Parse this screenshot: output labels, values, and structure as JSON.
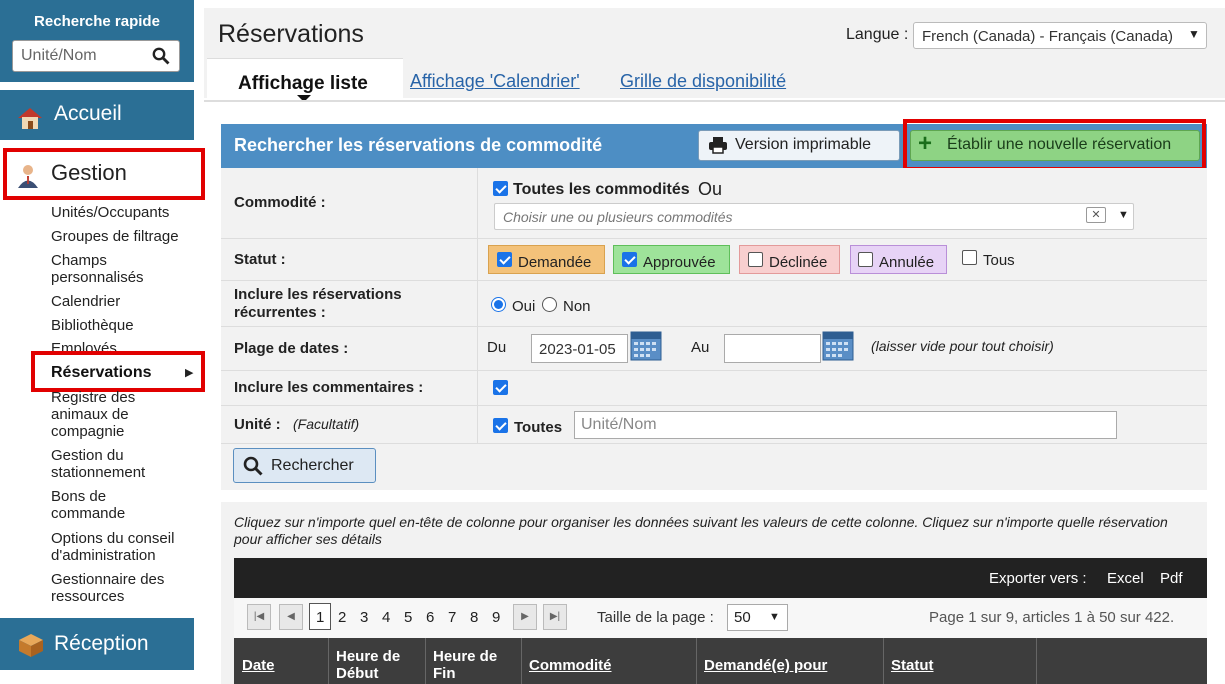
{
  "sidebar": {
    "quick_search_title": "Recherche rapide",
    "quick_search_placeholder": "Unité/Nom",
    "home_label": "Accueil",
    "management_label": "Gestion",
    "items": [
      {
        "label": "Unités/Occupants"
      },
      {
        "label": "Groupes de filtrage"
      },
      {
        "label": "Champs personnalisés"
      },
      {
        "label": "Calendrier"
      },
      {
        "label": "Bibliothèque"
      },
      {
        "label": "Employés"
      },
      {
        "label": "Réservations"
      },
      {
        "label": "Registre des animaux de compagnie"
      },
      {
        "label": "Gestion du stationnement"
      },
      {
        "label": "Bons de commande"
      },
      {
        "label": "Options du conseil d'administration"
      },
      {
        "label": "Gestionnaire des ressources"
      }
    ],
    "reception_label": "Réception"
  },
  "header": {
    "title": "Réservations",
    "language_label": "Langue :",
    "language_value": "French (Canada) - Français (Canada)",
    "tabs": [
      {
        "label": "Affichage liste"
      },
      {
        "label": "Affichage 'Calendrier'"
      },
      {
        "label": "Grille de disponibilité"
      }
    ]
  },
  "search": {
    "title": "Rechercher les réservations de commodité",
    "print_button": "Version imprimable",
    "new_button": "Établir une nouvelle réservation",
    "amenity_label": "Commodité :",
    "all_amenities": "Toutes les commodités",
    "or_text": "Ou",
    "amenity_placeholder": "Choisir une ou plusieurs commodités",
    "status_label": "Statut :",
    "statuses": [
      {
        "label": "Demandée",
        "checked": true,
        "bg": "#f3c27a",
        "border": "#d9a24f"
      },
      {
        "label": "Approuvée",
        "checked": true,
        "bg": "#9ee39a",
        "border": "#5fbf5a"
      },
      {
        "label": "Déclinée",
        "checked": false,
        "bg": "#f8cfcf",
        "border": "#e39a9a"
      },
      {
        "label": "Annulée",
        "checked": false,
        "bg": "#e7d3f6",
        "border": "#b98fd8"
      }
    ],
    "all_status": "Tous",
    "recurring_label": "Inclure les réservations récurrentes :",
    "yes": "Oui",
    "no": "Non",
    "date_label": "Plage de dates :",
    "from": "Du",
    "from_value": "2023-01-05",
    "to": "Au",
    "to_value": "",
    "date_hint": "(laisser vide pour tout choisir)",
    "comments_label": "Inclure les commentaires :",
    "unit_label": "Unité :",
    "unit_optional": "(Facultatif)",
    "unit_all": "Toutes",
    "unit_placeholder": "Unité/Nom",
    "search_button": "Rechercher"
  },
  "results": {
    "hint": "Cliquez sur n'importe quel en-tête de colonne pour organiser les données suivant les valeurs de cette colonne. Cliquez sur n'importe quelle réservation pour afficher ses détails",
    "export_label": "Exporter vers :",
    "export_excel": "Excel",
    "export_pdf": "Pdf",
    "pages": [
      "1",
      "2",
      "3",
      "4",
      "5",
      "6",
      "7",
      "8",
      "9"
    ],
    "page_size_label": "Taille de la page :",
    "page_size": "50",
    "page_info": "Page 1 sur 9, articles 1 à 50 sur 422.",
    "columns": [
      "Date",
      "Heure de Début",
      "Heure de Fin",
      "Commodité",
      "Demandé(e) pour",
      "Statut"
    ]
  },
  "colors": {
    "sidebar_accent": "#2b6f95",
    "panel_header": "#4d8ec4",
    "new_button": "#8ed384",
    "highlight": "#e10000"
  }
}
